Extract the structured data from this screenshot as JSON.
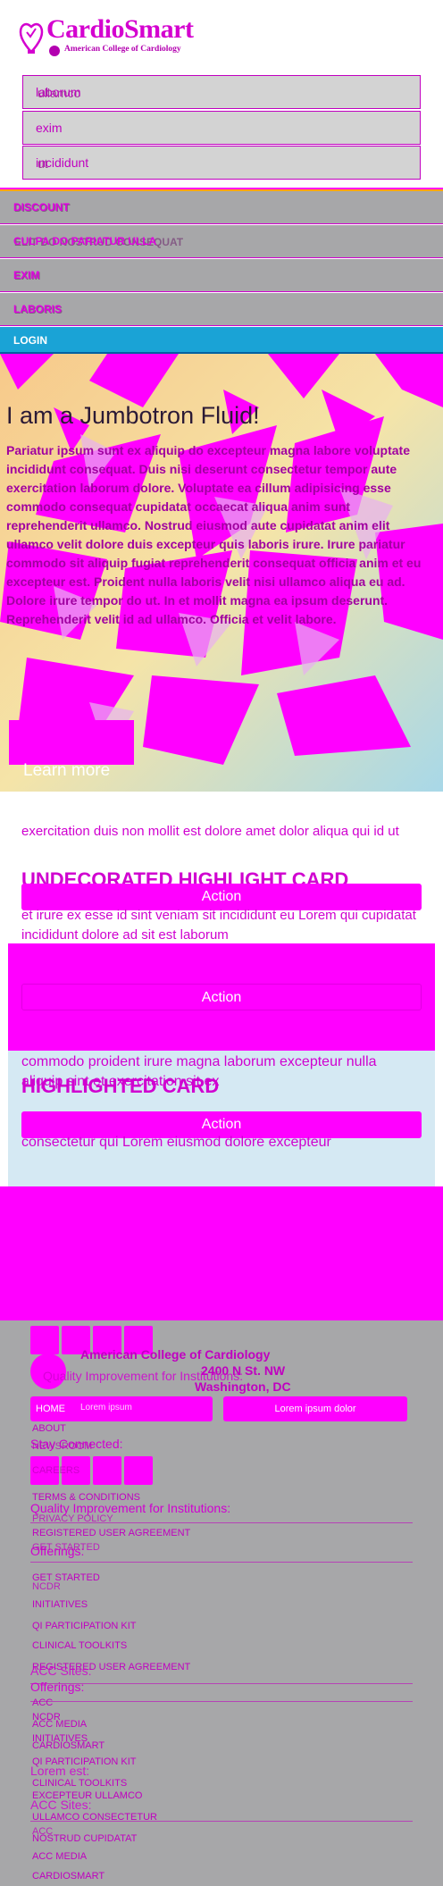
{
  "header": {
    "logo_title": "CardioSmart",
    "logo_sub": "American College of Cardiology",
    "subnav": [
      "laborum",
      "exim",
      "incididunt"
    ],
    "subnav_ghost": [
      "ullamco",
      "",
      "ut"
    ]
  },
  "mainnav": {
    "items": [
      "DISCOUNT",
      "CULPA DO PARIATUR ULLA",
      "EXIM",
      "LABORIS",
      "LOGIN"
    ],
    "ghost": [
      "DISCOUNT",
      "ELIT DO NOSTRUD CONSEQUAT",
      "EXIM",
      "LABORIS"
    ]
  },
  "jumbotron": {
    "title": "I am a Jumbotron Fluid!",
    "body": "Pariatur ipsum sunt ex aliquip do excepteur magna labore voluptate incididunt consequat. Duis nisi deserunt consectetur tempor aute exercitation laborum dolore. Voluptate ea cillum adipisicing esse commodo consequat cupidatat occaecat aliqua anim sunt reprehenderit ullamco. Nostrud eiusmod aute cupidatat anim elit ullamco velit dolore duis excepteur quis laboris irure. Irure pariatur commodo sit aliquip fugiat reprehenderit consequat officia anim et eu excepteur est. Proident nulla laboris velit nisi ullamco aliqua eu ad. Dolore irure tempor do ut. In et mollit magna ea ipsum deserunt. Reprehenderit velit id ad ullamco. Officia et velit labore.",
    "learn_more": "Learn more"
  },
  "cards": {
    "filler1": "exercitation duis non mollit est dolore amet dolor aliqua qui id ut",
    "title1": "UNDECORATED HIGHLIGHT CARD",
    "action1": "Action",
    "filler2": "et irure ex esse id sint veniam sit incididunt eu Lorem qui cupidatat incididunt dolore ad sit est laborum",
    "action2": "Action",
    "filler3": "commodo proident irure magna laborum excepteur nulla",
    "filler3b": "aliquip sint et exercitation sit ex",
    "title2": "HIGHLIGHTED CARD",
    "action3": "Action",
    "filler4": "consectetur qui Lorem eiusmod dolore excepteur"
  },
  "footer": {
    "org": "American College of Cardiology",
    "addr1": "2400 N St. NW",
    "addr2": "Washington, DC",
    "buttons": [
      "HOME",
      "Lorem ipsum",
      "Lorem ipsum dolor"
    ],
    "stay_connected": "Stay Connected:",
    "quality1": "Quality Improvement for Institutions:",
    "links_a": [
      "ABOUT",
      "NEWSROOM",
      "CAREERS",
      "TERMS & CONDITIONS",
      "PRIVACY POLICY",
      "REGISTERED USER AGREEMENT"
    ],
    "quality2": "Quality Improvement for Institutions:",
    "offerings1": "Offerings:",
    "links_b": [
      "GET STARTED",
      "NCDR",
      "INITIATIVES",
      "QI PARTICIPATION KIT",
      "CLINICAL TOOLKITS",
      "REGISTERED USER AGREEMENT"
    ],
    "acc_sites1": "ACC Sites:",
    "offerings2": "Offerings:",
    "links_c": [
      "ACC",
      "NCDR",
      "ACC MEDIA",
      "INITIATIVES",
      "CARDIOSMART",
      "QI PARTICIPATION KIT",
      "CLINICAL TOOLKITS",
      "EXCEPTEUR ULLAMCO"
    ],
    "lorem": "Lorem est:",
    "acc_sites2": "ACC Sites:",
    "links_d": [
      "ULLAMCO CONSECTETUR",
      "ACC",
      "NOSTRUD CUPIDATAT",
      "ACC MEDIA",
      "CARDIOSMART"
    ]
  },
  "colors": {
    "brand": "#d400cf",
    "accent": "#ff00ff",
    "nav_gray": "#a7a7a9",
    "login_blue": "#1aa3d6",
    "jumbo_bg": "#f5dfa1"
  }
}
